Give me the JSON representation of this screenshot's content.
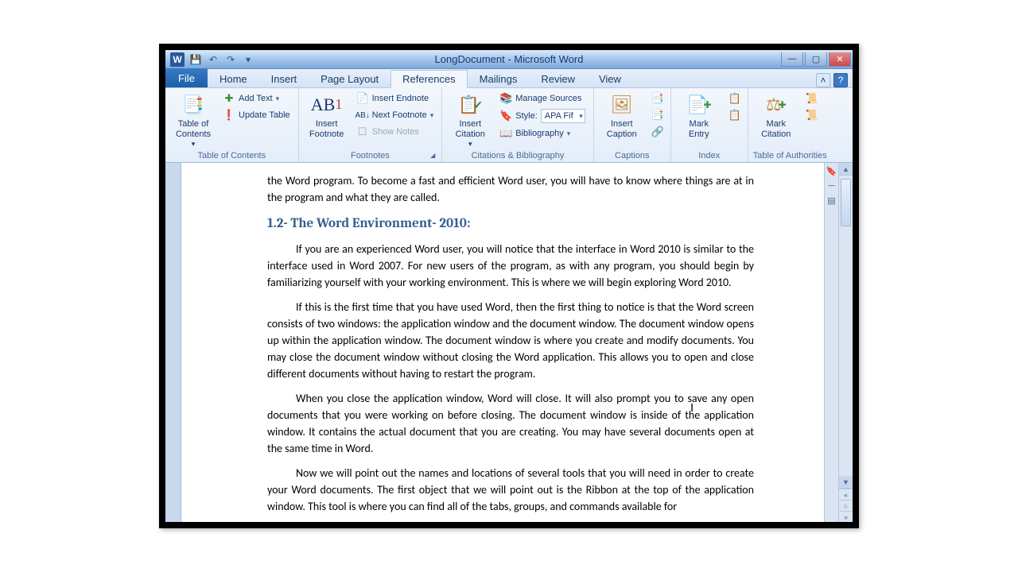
{
  "window": {
    "title": "LongDocument - Microsoft Word"
  },
  "qat": {
    "save": "💾",
    "undo": "↶",
    "redo": "↷",
    "customize": "▾"
  },
  "tabs": {
    "file": "File",
    "items": [
      {
        "label": "Home"
      },
      {
        "label": "Insert"
      },
      {
        "label": "Page Layout"
      },
      {
        "label": "References",
        "active": true
      },
      {
        "label": "Mailings"
      },
      {
        "label": "Review"
      },
      {
        "label": "View"
      }
    ]
  },
  "ribbon": {
    "toc": {
      "label": "Table of Contents",
      "big": "Table of\nContents",
      "add_text": "Add Text",
      "update": "Update Table"
    },
    "footnotes": {
      "label": "Footnotes",
      "big": "Insert\nFootnote",
      "endnote": "Insert Endnote",
      "next": "Next Footnote",
      "show": "Show Notes"
    },
    "citations": {
      "label": "Citations & Bibliography",
      "big": "Insert\nCitation",
      "manage": "Manage Sources",
      "style_label": "Style:",
      "style_value": "APA Fift",
      "biblio": "Bibliography"
    },
    "captions": {
      "label": "Captions",
      "big": "Insert\nCaption"
    },
    "index": {
      "label": "Index",
      "big": "Mark\nEntry"
    },
    "toa": {
      "label": "Table of Authorities",
      "big": "Mark\nCitation"
    }
  },
  "document": {
    "p1": "the Word program. To become a fast and efficient Word user, you will have to know where things are at in the program and what they are called.",
    "h": "1.2- The Word Environment- 2010:",
    "p2": "If you are an experienced Word user, you will notice that the interface in Word 2010 is similar to the interface used in Word 2007. For new users of the program, as with any program, you should begin by familiarizing yourself with your working environment. This is where we will begin exploring Word 2010.",
    "p3": "If this is the first time that you have used Word, then the first thing to notice is that the Word screen consists of two windows: the application window and the document window. The document window opens up within the application window. The document window is where you create and modify documents. You may close the document window without closing the Word application. This allows you to open and close different documents without having to restart the program.",
    "p4": "When you close the application window, Word will close. It will also prompt you to save any open documents that you were working on before closing. The document window is inside of the application window. It contains the actual document that you are creating. You may have several documents open at the same time in Word.",
    "p5": "Now we will point out the names and locations of several tools that you will need in order to create your Word documents. The first object that we will point out is the Ribbon at the top of the application window. This tool is where you can find all of the tabs, groups, and commands available for"
  }
}
